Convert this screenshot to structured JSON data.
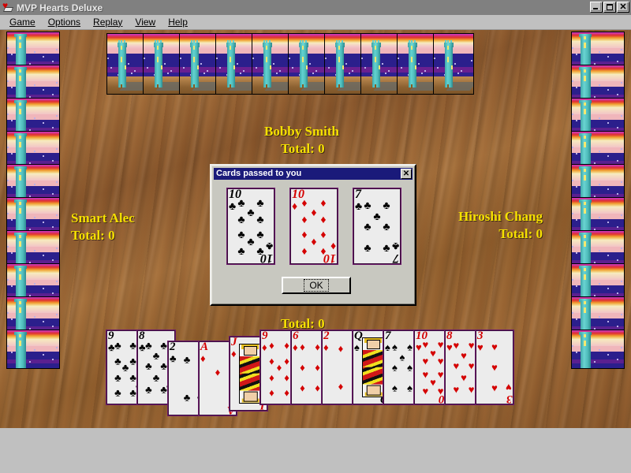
{
  "window": {
    "title": "MVP Hearts Deluxe",
    "icon": "hearts-card-icon",
    "buttons": {
      "minimize": "_",
      "maximize": "□",
      "close": "✕"
    }
  },
  "menubar": {
    "items": [
      {
        "label": "Game",
        "accel": "G"
      },
      {
        "label": "Options",
        "accel": "O"
      },
      {
        "label": "Replay",
        "accel": "R"
      },
      {
        "label": "View",
        "accel": "V"
      },
      {
        "label": "Help",
        "accel": "H"
      }
    ]
  },
  "table": {
    "felt_color": "#9a6536",
    "card_back_name": "castle-tower-sunset-back"
  },
  "players": {
    "north": {
      "name": "Bobby Smith",
      "total_label": "Total: 0",
      "total": 0,
      "cards_in_hand": 10
    },
    "west": {
      "name": "Smart Alec",
      "total_label": "Total: 0",
      "total": 0,
      "cards_in_hand": 10
    },
    "east": {
      "name": "Hiroshi Chang",
      "total_label": "Total: 0",
      "total": 0,
      "cards_in_hand": 10
    },
    "south": {
      "name": "",
      "total_label": "Total: 0",
      "total": 0,
      "cards_in_hand": 13
    }
  },
  "hand": {
    "cards": [
      {
        "rank": "9",
        "suit": "clubs",
        "glyph": "♣",
        "color": "black"
      },
      {
        "rank": "8",
        "suit": "clubs",
        "glyph": "♣",
        "color": "black"
      },
      {
        "rank": "2",
        "suit": "clubs",
        "glyph": "♣",
        "color": "black"
      },
      {
        "rank": "A",
        "suit": "diamonds",
        "glyph": "♦",
        "color": "red"
      },
      {
        "rank": "J",
        "suit": "diamonds",
        "glyph": "♦",
        "color": "red"
      },
      {
        "rank": "9",
        "suit": "diamonds",
        "glyph": "♦",
        "color": "red"
      },
      {
        "rank": "6",
        "suit": "diamonds",
        "glyph": "♦",
        "color": "red"
      },
      {
        "rank": "2",
        "suit": "diamonds",
        "glyph": "♦",
        "color": "red"
      },
      {
        "rank": "Q",
        "suit": "spades",
        "glyph": "♠",
        "color": "black"
      },
      {
        "rank": "7",
        "suit": "spades",
        "glyph": "♠",
        "color": "black"
      },
      {
        "rank": "10",
        "suit": "hearts",
        "glyph": "♥",
        "color": "red"
      },
      {
        "rank": "8",
        "suit": "hearts",
        "glyph": "♥",
        "color": "red"
      },
      {
        "rank": "3",
        "suit": "hearts",
        "glyph": "♥",
        "color": "red"
      }
    ]
  },
  "dialog": {
    "title": "Cards passed to you",
    "close_label": "✕",
    "ok_label": "OK",
    "cards": [
      {
        "rank": "10",
        "suit": "clubs",
        "glyph": "♣",
        "color": "black"
      },
      {
        "rank": "10",
        "suit": "diamonds",
        "glyph": "♦",
        "color": "red"
      },
      {
        "rank": "7",
        "suit": "clubs",
        "glyph": "♣",
        "color": "black"
      }
    ]
  },
  "colors": {
    "title_bar": "#808080",
    "dialog_title_bar": "#1a1a7a",
    "label_yellow": "#f5e000",
    "card_border": "#6b1a6b",
    "chrome": "#c0c0c0"
  }
}
